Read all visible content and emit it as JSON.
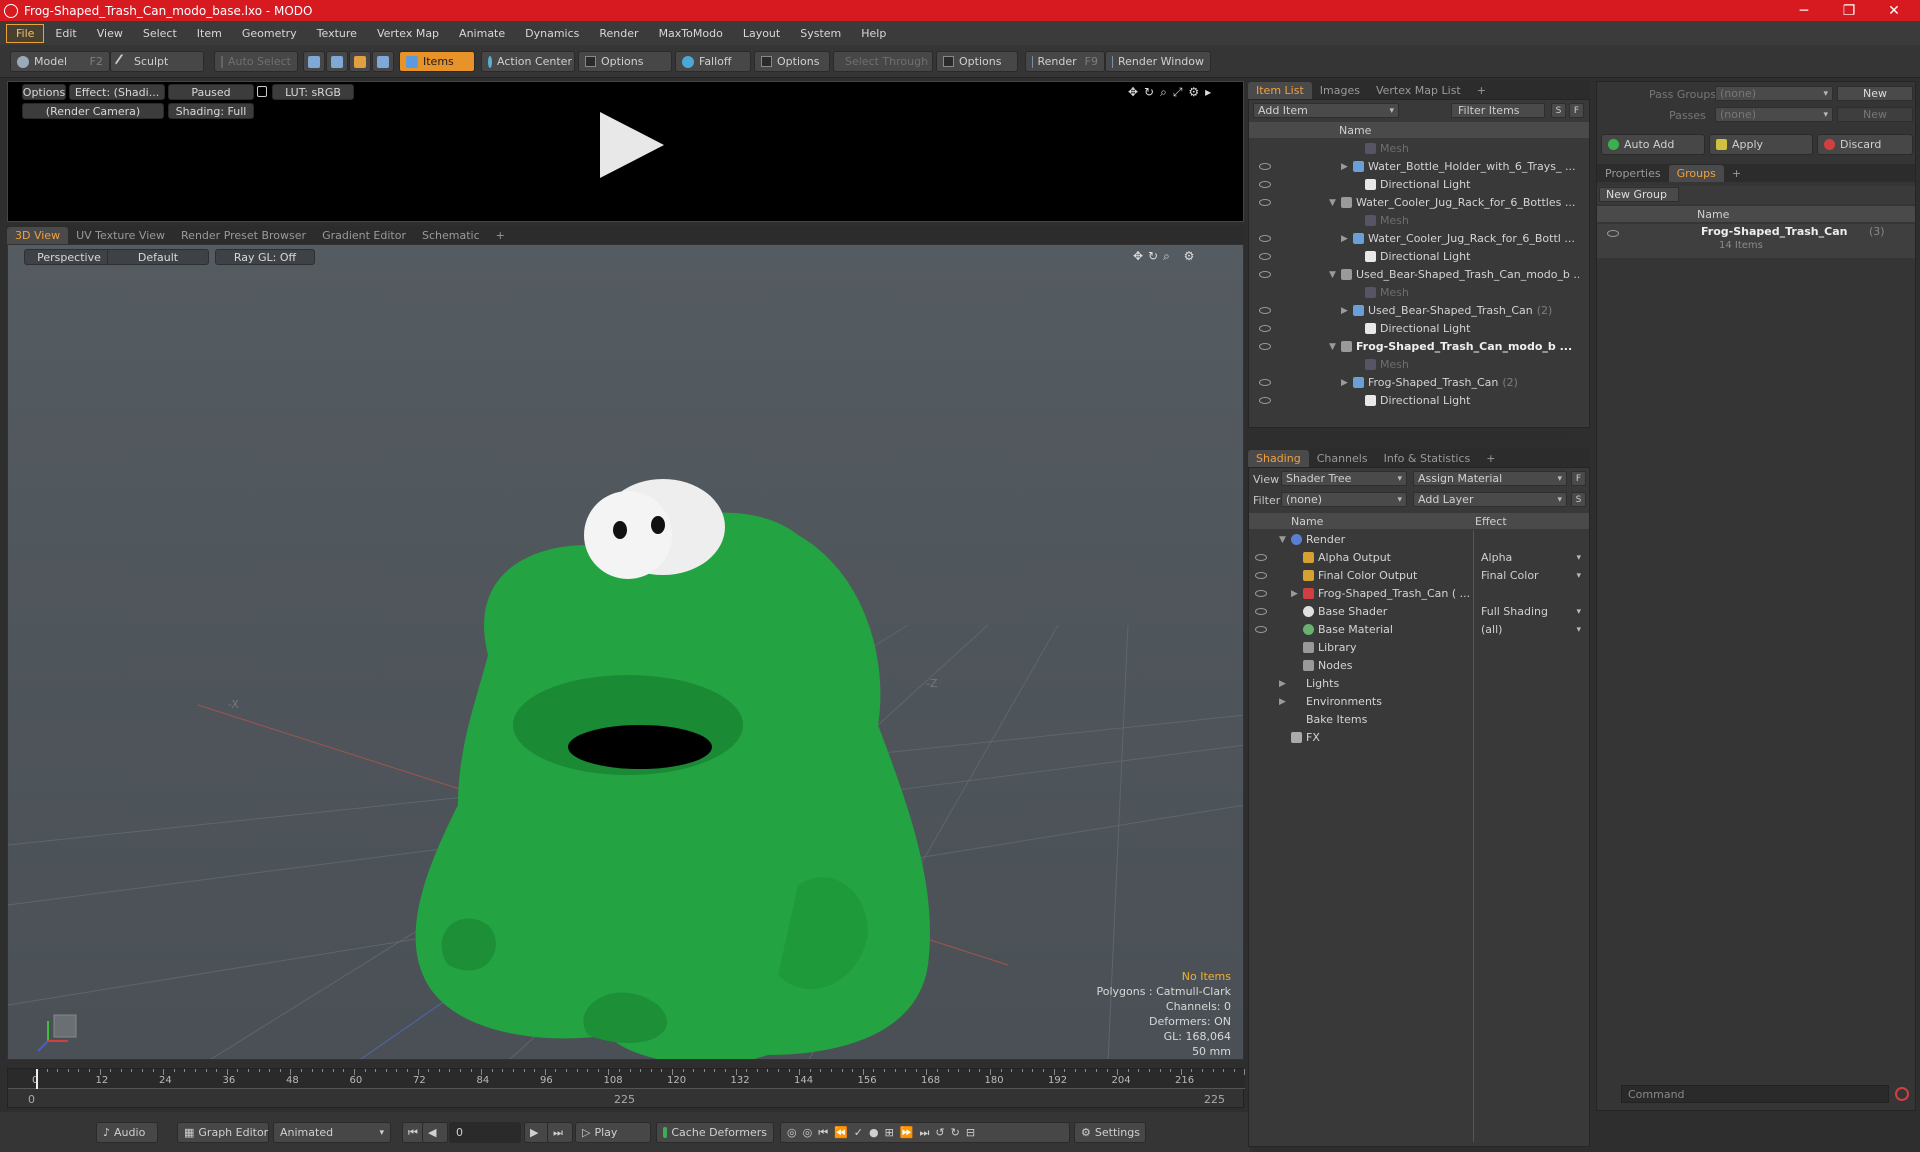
{
  "window": {
    "title": "Frog-Shaped_Trash_Can_modo_base.lxo - MODO",
    "minimize": "─",
    "maximize": "❐",
    "close": "✕"
  },
  "menu": [
    "File",
    "Edit",
    "View",
    "Select",
    "Item",
    "Geometry",
    "Texture",
    "Vertex Map",
    "Animate",
    "Dynamics",
    "Render",
    "MaxToModo",
    "Layout",
    "System",
    "Help"
  ],
  "toolbar": {
    "model": "Model",
    "model_key": "F2",
    "sculpt": "Sculpt",
    "auto_select": "Auto Select",
    "items": "Items",
    "action_center": "Action Center",
    "options1": "Options",
    "falloff": "Falloff",
    "options2": "Options",
    "select_through": "Select Through",
    "options3": "Options",
    "render": "Render",
    "render_key": "F9",
    "render_window": "Render Window"
  },
  "preview": {
    "options": "Options",
    "effect": "Effect: (Shadi...",
    "paused": "Paused",
    "lut": "LUT: sRGB",
    "camera": "(Render Camera)",
    "shading": "Shading: Full"
  },
  "viewport_tabs": [
    "3D View",
    "UV Texture View",
    "Render Preset Browser",
    "Gradient Editor",
    "Schematic"
  ],
  "viewport": {
    "projection": "Perspective",
    "style": "Default",
    "raygl": "Ray GL: Off",
    "stats": [
      "No Items",
      "Polygons : Catmull-Clark",
      "Channels: 0",
      "Deformers: ON",
      "GL: 168,064",
      "50 mm"
    ],
    "axis_labels": [
      "-X",
      "-Z"
    ]
  },
  "timeline": {
    "ticks": [
      "0",
      "12",
      "24",
      "36",
      "48",
      "60",
      "72",
      "84",
      "96",
      "108",
      "120",
      "132",
      "144",
      "156",
      "168",
      "180",
      "192",
      "204",
      "216"
    ],
    "start": "0",
    "mid": "225",
    "end": "225"
  },
  "bottombar": {
    "audio": "Audio",
    "graph_editor": "Graph Editor",
    "animated": "Animated",
    "frame": "0",
    "play": "Play",
    "cache": "Cache Deformers",
    "settings": "Settings"
  },
  "itemlist": {
    "tabs": [
      "Item List",
      "Images",
      "Vertex Map List"
    ],
    "add_item": "Add Item",
    "filter": "Filter Items",
    "s": "S",
    "f": "F",
    "col_name": "Name",
    "rows": [
      {
        "name": "Mesh",
        "indent": 3,
        "kind": "mesh",
        "dim": true,
        "tri": "",
        "count": ""
      },
      {
        "name": "Water_Bottle_Holder_with_6_Trays_ ...",
        "indent": 2,
        "kind": "mesh",
        "dim": false,
        "tri": "▶",
        "count": ""
      },
      {
        "name": "Directional Light",
        "indent": 3,
        "kind": "light",
        "dim": false,
        "tri": "",
        "count": ""
      },
      {
        "name": "Water_Cooler_Jug_Rack_for_6_Bottles ...",
        "indent": 1,
        "kind": "scene",
        "dim": false,
        "tri": "▼",
        "count": ""
      },
      {
        "name": "Mesh",
        "indent": 3,
        "kind": "mesh",
        "dim": true,
        "tri": "",
        "count": ""
      },
      {
        "name": "Water_Cooler_Jug_Rack_for_6_Bottl ...",
        "indent": 2,
        "kind": "mesh",
        "dim": false,
        "tri": "▶",
        "count": ""
      },
      {
        "name": "Directional Light",
        "indent": 3,
        "kind": "light",
        "dim": false,
        "tri": "",
        "count": ""
      },
      {
        "name": "Used_Bear-Shaped_Trash_Can_modo_b ...",
        "indent": 1,
        "kind": "scene",
        "dim": false,
        "tri": "▼",
        "count": ""
      },
      {
        "name": "Mesh",
        "indent": 3,
        "kind": "mesh",
        "dim": true,
        "tri": "",
        "count": ""
      },
      {
        "name": "Used_Bear-Shaped_Trash_Can",
        "indent": 2,
        "kind": "mesh",
        "dim": false,
        "tri": "▶",
        "count": "(2)"
      },
      {
        "name": "Directional Light",
        "indent": 3,
        "kind": "light",
        "dim": false,
        "tri": "",
        "count": ""
      },
      {
        "name": "Frog-Shaped_Trash_Can_modo_b ...",
        "indent": 1,
        "kind": "scene",
        "dim": false,
        "bold": true,
        "tri": "▼",
        "count": ""
      },
      {
        "name": "Mesh",
        "indent": 3,
        "kind": "mesh",
        "dim": true,
        "tri": "",
        "count": ""
      },
      {
        "name": "Frog-Shaped_Trash_Can",
        "indent": 2,
        "kind": "mesh",
        "dim": false,
        "tri": "▶",
        "count": "(2)"
      },
      {
        "name": "Directional Light",
        "indent": 3,
        "kind": "light",
        "dim": false,
        "tri": "",
        "count": ""
      }
    ]
  },
  "shading": {
    "tabs": [
      "Shading",
      "Channels",
      "Info & Statistics"
    ],
    "view_label": "View",
    "view_value": "Shader Tree",
    "assign_material": "Assign Material",
    "filter_label": "Filter",
    "filter_value": "(none)",
    "add_layer": "Add Layer",
    "f": "F",
    "s": "S",
    "col_name": "Name",
    "col_effect": "Effect",
    "rows": [
      {
        "name": "Render",
        "effect": "",
        "indent": 0,
        "tri": "▼",
        "kind": "render",
        "eye": false
      },
      {
        "name": "Alpha Output",
        "effect": "Alpha",
        "indent": 1,
        "tri": "",
        "kind": "output",
        "eye": true
      },
      {
        "name": "Final Color Output",
        "effect": "Final Color",
        "indent": 1,
        "tri": "",
        "kind": "output",
        "eye": true
      },
      {
        "name": "Frog-Shaped_Trash_Can ( ...",
        "effect": "",
        "indent": 1,
        "tri": "▶",
        "kind": "mask",
        "eye": true
      },
      {
        "name": "Base Shader",
        "effect": "Full Shading",
        "indent": 1,
        "tri": "",
        "kind": "shader",
        "eye": true
      },
      {
        "name": "Base Material",
        "effect": "(all)",
        "indent": 1,
        "tri": "",
        "kind": "material",
        "eye": true
      },
      {
        "name": "Library",
        "effect": "",
        "indent": 1,
        "tri": "",
        "kind": "folder",
        "eye": false
      },
      {
        "name": "Nodes",
        "effect": "",
        "indent": 1,
        "tri": "",
        "kind": "folder",
        "eye": false
      },
      {
        "name": "Lights",
        "effect": "",
        "indent": 0,
        "tri": "▶",
        "kind": "none",
        "eye": false
      },
      {
        "name": "Environments",
        "effect": "",
        "indent": 0,
        "tri": "▶",
        "kind": "none",
        "eye": false
      },
      {
        "name": "Bake Items",
        "effect": "",
        "indent": 0,
        "tri": "",
        "kind": "none",
        "eye": false
      },
      {
        "name": "FX",
        "effect": "",
        "indent": 0,
        "tri": "",
        "kind": "fx",
        "eye": false
      }
    ]
  },
  "groups": {
    "pass_groups_label": "Pass Groups",
    "pass_groups_value": "(none)",
    "new1": "New",
    "passes_label": "Passes",
    "passes_value": "(none)",
    "new2": "New",
    "auto_add": "Auto Add",
    "apply": "Apply",
    "discard": "Discard",
    "tabs": [
      "Properties",
      "Groups"
    ],
    "new_group": "New Group",
    "col_name": "Name",
    "group_name": "Frog-Shaped_Trash_Can",
    "group_count": "(3)",
    "group_items": "14 Items"
  },
  "command": {
    "placeholder": "Command"
  },
  "colors": {
    "accent": "#e8922a",
    "titlebar": "#d71920",
    "frog": "#23a341"
  }
}
